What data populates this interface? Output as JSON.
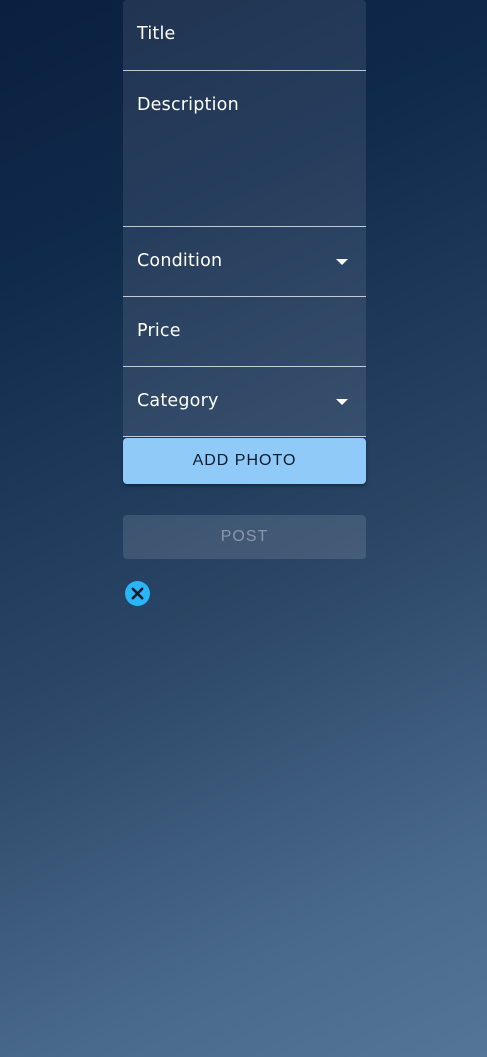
{
  "form": {
    "title_label": "Title",
    "description_label": "Description",
    "condition_label": "Condition",
    "price_label": "Price",
    "category_label": "Category",
    "add_photo_label": "ADD PHOTO",
    "post_label": "POST"
  },
  "icons": {
    "condition_dropdown": "caret-down-icon",
    "category_dropdown": "caret-down-icon",
    "close": "close-circle-icon"
  },
  "colors": {
    "add_photo_button": "#90caf9",
    "close_icon": "#29b6f6"
  }
}
